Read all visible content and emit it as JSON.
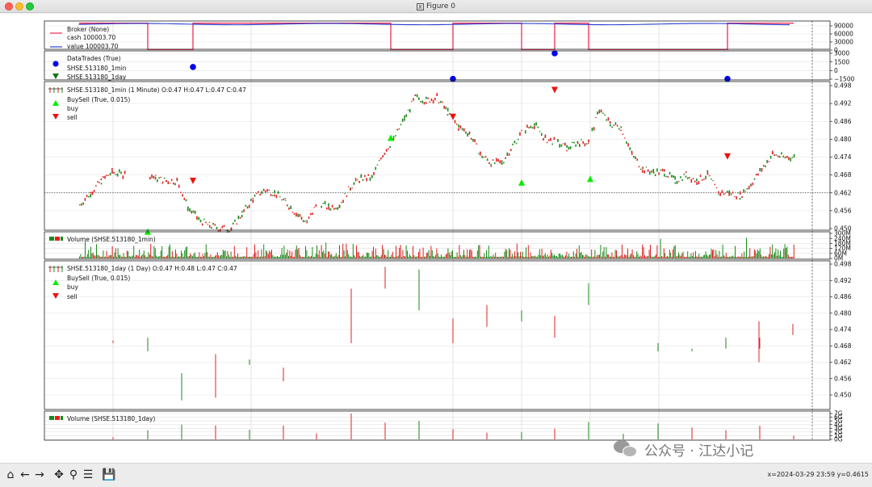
{
  "window": {
    "title": "Figure 0"
  },
  "panels": {
    "broker": {
      "legend_title": "Broker (None)",
      "legend_items": [
        "cash 100003.70",
        "value 100003.70"
      ],
      "yticks": [
        "90000",
        "60000",
        "30000",
        "0"
      ]
    },
    "trades": {
      "legend_title": "DataTrades (True)",
      "legend_items": [
        "SHSE.513180_1min",
        "SHSE.513180_1day"
      ],
      "yticks": [
        "3000",
        "1500",
        "0",
        "−1500"
      ]
    },
    "price_1min": {
      "legend_title": "SHSE.513180_1min (1 Minute) O:0.47 H:0.47 L:0.47 C:0.47",
      "legend_buysell": "BuySell (True, 0.015)",
      "legend_buy": "buy",
      "legend_sell": "sell",
      "yticks": [
        "0.498",
        "0.492",
        "0.486",
        "0.480",
        "0.474",
        "0.468",
        "0.462",
        "0.456",
        "0.450"
      ],
      "last_price": 0.462
    },
    "volume_1min": {
      "legend": "Volume (SHSE.513180_1min)",
      "yticks": [
        "300M",
        "240M",
        "180M",
        "120M",
        "60M",
        "0M"
      ]
    },
    "price_1day": {
      "legend_title": "SHSE.513180_1day (1 Day) O:0.47 H:0.48 L:0.47 C:0.47",
      "legend_buysell": "BuySell (True, 0.015)",
      "legend_buy": "buy",
      "legend_sell": "sell",
      "yticks": [
        "0.498",
        "0.492",
        "0.486",
        "0.480",
        "0.474",
        "0.468",
        "0.462",
        "0.456",
        "0.450"
      ]
    },
    "volume_1day": {
      "legend": "Volume (SHSE.513180_1day)",
      "yticks": [
        "7G",
        "6G",
        "5G",
        "4G",
        "3G",
        "2G",
        "1G",
        "0G"
      ]
    }
  },
  "colors": {
    "up": "#1a8a1a",
    "down": "#e02020",
    "cash": "#e8305a",
    "value": "#2a3fd0",
    "buy": "#00ee00",
    "sell": "#ee1111",
    "trade": "#0000ee"
  },
  "chart_data": {
    "type": "line",
    "price_1min_close": [
      0.458,
      0.462,
      0.466,
      0.469,
      0.468,
      0.47,
      0.469,
      0.467,
      0.466,
      0.466,
      0.457,
      0.453,
      0.451,
      0.45,
      0.45,
      0.455,
      0.46,
      0.463,
      0.462,
      0.459,
      0.455,
      0.452,
      0.459,
      0.457,
      0.458,
      0.464,
      0.467,
      0.467,
      0.475,
      0.48,
      0.487,
      0.494,
      0.493,
      0.494,
      0.489,
      0.484,
      0.482,
      0.475,
      0.472,
      0.472,
      0.478,
      0.483,
      0.485,
      0.48,
      0.479,
      0.477,
      0.479,
      0.479,
      0.49,
      0.485,
      0.484,
      0.475,
      0.47,
      0.469,
      0.469,
      0.466,
      0.468,
      0.466,
      0.468,
      0.462,
      0.462,
      0.461,
      0.465,
      0.47,
      0.475,
      0.474,
      0.474
    ],
    "price_1day_bars": [
      {
        "o": 0.469,
        "c": 0.469,
        "h": 0.47,
        "l": 0.469,
        "up": false
      },
      {
        "o": 0.466,
        "c": 0.471,
        "h": 0.471,
        "l": 0.466,
        "up": true
      },
      {
        "o": 0.453,
        "c": 0.458,
        "h": 0.458,
        "l": 0.448,
        "up": true
      },
      {
        "o": 0.465,
        "c": 0.449,
        "h": 0.465,
        "l": 0.449,
        "up": false
      },
      {
        "o": 0.463,
        "c": 0.461,
        "h": 0.463,
        "l": 0.461,
        "up": true
      },
      {
        "o": 0.46,
        "c": 0.455,
        "h": 0.46,
        "l": 0.455,
        "up": false
      },
      {
        "o": 0.467,
        "c": 0.467,
        "h": 0.467,
        "l": 0.467,
        "up": false
      },
      {
        "o": 0.489,
        "c": 0.469,
        "h": 0.489,
        "l": 0.469,
        "up": false
      },
      {
        "o": 0.497,
        "c": 0.489,
        "h": 0.497,
        "l": 0.489,
        "up": false
      },
      {
        "o": 0.484,
        "c": 0.496,
        "h": 0.496,
        "l": 0.481,
        "up": true
      },
      {
        "o": 0.478,
        "c": 0.469,
        "h": 0.478,
        "l": 0.469,
        "up": false
      },
      {
        "o": 0.483,
        "c": 0.475,
        "h": 0.483,
        "l": 0.475,
        "up": false
      },
      {
        "o": 0.477,
        "c": 0.481,
        "h": 0.481,
        "l": 0.477,
        "up": true
      },
      {
        "o": 0.479,
        "c": 0.471,
        "h": 0.479,
        "l": 0.471,
        "up": false
      },
      {
        "o": 0.483,
        "c": 0.491,
        "h": 0.491,
        "l": 0.483,
        "up": true
      },
      {
        "o": 0.478,
        "c": 0.478,
        "h": 0.478,
        "l": 0.478,
        "up": false
      },
      {
        "o": 0.466,
        "c": 0.469,
        "h": 0.469,
        "l": 0.466,
        "up": true
      },
      {
        "o": 0.466,
        "c": 0.466,
        "h": 0.467,
        "l": 0.466,
        "up": true
      },
      {
        "o": 0.47,
        "c": 0.467,
        "h": 0.471,
        "l": 0.467,
        "up": true
      },
      {
        "o": 0.471,
        "c": 0.467,
        "h": 0.471,
        "l": 0.467,
        "up": false
      },
      {
        "o": 0.47,
        "c": 0.47,
        "h": 0.47,
        "l": 0.47,
        "up": false
      },
      {
        "o": 0.477,
        "c": 0.462,
        "h": 0.477,
        "l": 0.462,
        "up": false
      },
      {
        "o": 0.476,
        "c": 0.472,
        "h": 0.476,
        "l": 0.472,
        "up": false
      }
    ]
  },
  "toolbar": {
    "coords": "x=2024-03-29 23:59 y=0.4615"
  },
  "watermark": {
    "text": "公众号 · 江达小记"
  }
}
